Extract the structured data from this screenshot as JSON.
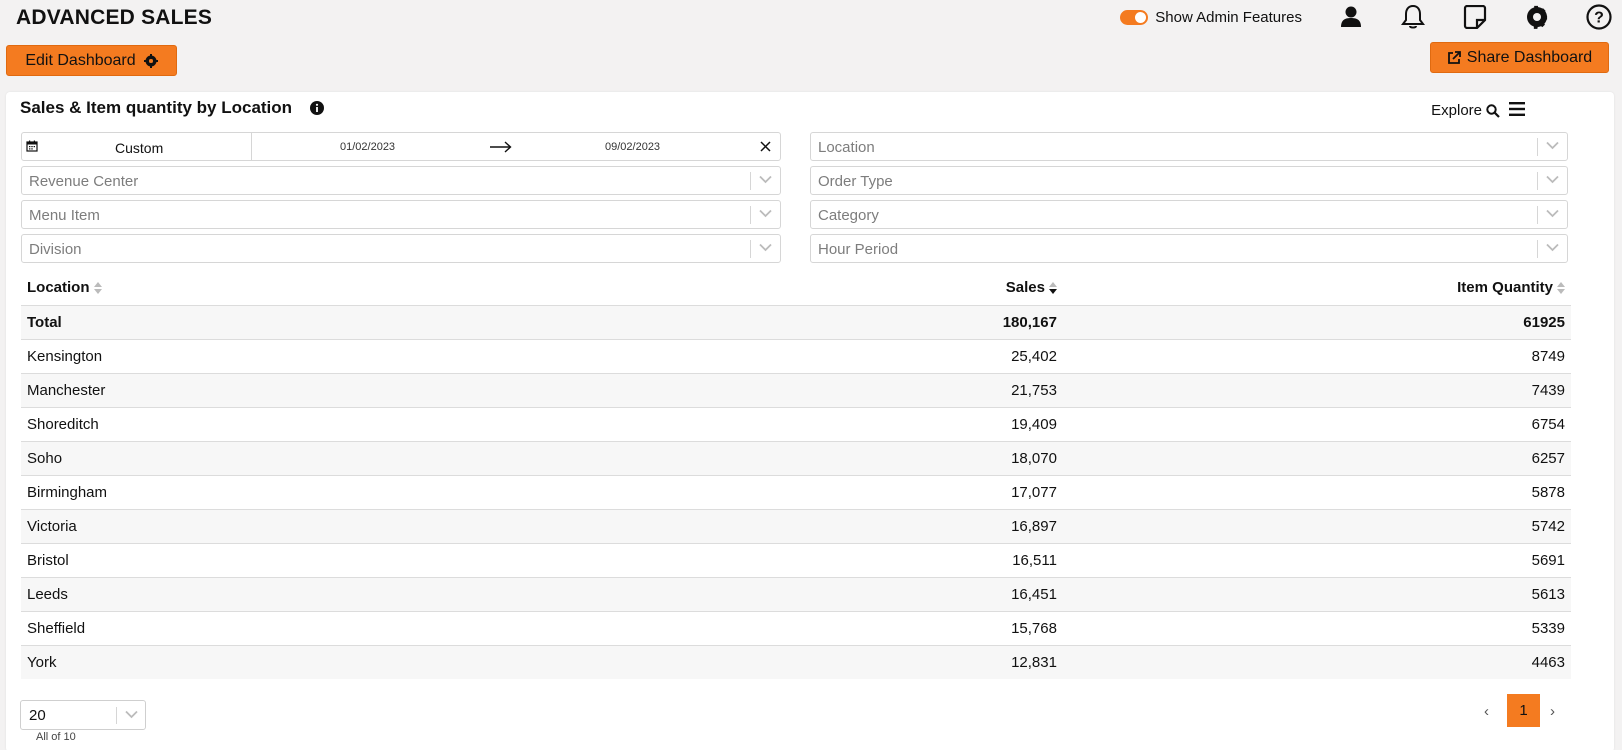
{
  "app": {
    "title": "ADVANCED SALES"
  },
  "topbar": {
    "admin_toggle_label": "Show Admin Features"
  },
  "toolbar": {
    "edit_label": "Edit Dashboard",
    "share_label": "Share Dashboard"
  },
  "card": {
    "title": "Sales & Item quantity by Location",
    "explore_label": "Explore"
  },
  "filters": {
    "date": {
      "preset": "Custom",
      "from": "01/02/2023",
      "to": "09/02/2023"
    },
    "location": "Location",
    "revenue_center": "Revenue Center",
    "order_type": "Order Type",
    "menu_item": "Menu Item",
    "category": "Category",
    "division": "Division",
    "hour_period": "Hour Period"
  },
  "table": {
    "columns": [
      "Location",
      "Sales",
      "Item Quantity"
    ],
    "rows": [
      [
        "Total",
        "180,167",
        "61925"
      ],
      [
        "Kensington",
        "25,402",
        "8749"
      ],
      [
        "Manchester",
        "21,753",
        "7439"
      ],
      [
        "Shoreditch",
        "19,409",
        "6754"
      ],
      [
        "Soho",
        "18,070",
        "6257"
      ],
      [
        "Birmingham",
        "17,077",
        "5878"
      ],
      [
        "Victoria",
        "16,897",
        "5742"
      ],
      [
        "Bristol",
        "16,511",
        "5691"
      ],
      [
        "Leeds",
        "16,451",
        "5613"
      ],
      [
        "Sheffield",
        "15,768",
        "5339"
      ],
      [
        "York",
        "12,831",
        "4463"
      ]
    ]
  },
  "pagination": {
    "page_size": "20",
    "summary": "All of 10",
    "current_page": "1",
    "prev": "‹",
    "next": "›"
  },
  "colors": {
    "accent": "#f47b20"
  }
}
